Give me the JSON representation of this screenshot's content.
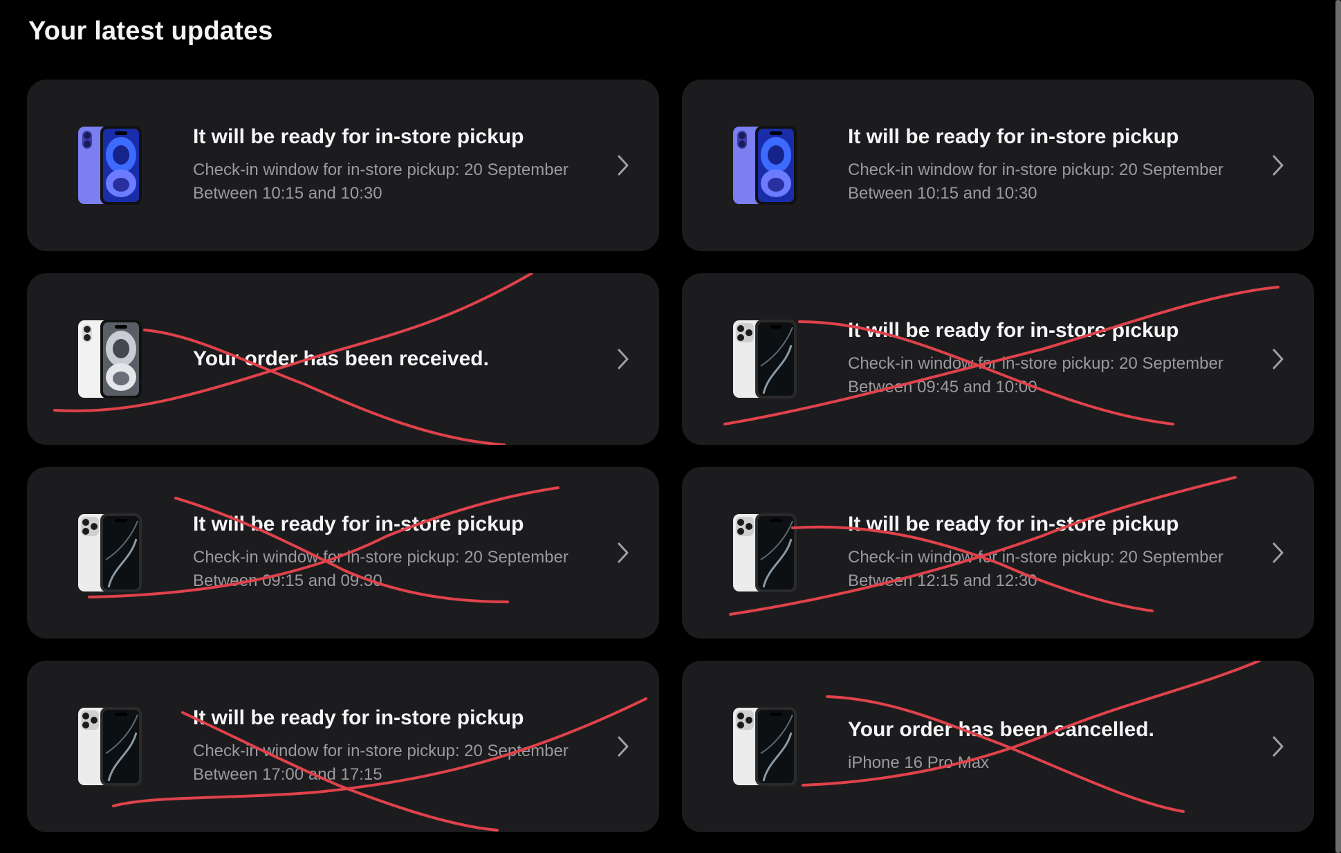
{
  "page": {
    "title": "Your latest updates"
  },
  "colors": {
    "background": "#000000",
    "card": "#1c1c1e",
    "scribble": "#e0424b",
    "muted_text": "#9a9aa0"
  },
  "cards": [
    {
      "phone": "iphone-16-ultramarine-icon",
      "title": "It will be ready for in-store pickup",
      "line1": "Check-in window for in-store pickup: 20 September",
      "line2": "Between 10:15 and 10:30",
      "crossed_out": false
    },
    {
      "phone": "iphone-16-ultramarine-icon",
      "title": "It will be ready for in-store pickup",
      "line1": "Check-in window for in-store pickup: 20 September",
      "line2": "Between 10:15 and 10:30",
      "crossed_out": false
    },
    {
      "phone": "iphone-16-white-icon",
      "title": "Your order has been received.",
      "crossed_out": true
    },
    {
      "phone": "iphone-16-pro-titanium-icon",
      "title": "It will be ready for in-store pickup",
      "line1": "Check-in window for in-store pickup: 20 September",
      "line2": "Between 09:45 and 10:00",
      "crossed_out": true
    },
    {
      "phone": "iphone-16-pro-titanium-icon",
      "title": "It will be ready for in-store pickup",
      "line1": "Check-in window for in-store pickup: 20 September",
      "line2": "Between 09:15 and 09:30",
      "crossed_out": true
    },
    {
      "phone": "iphone-16-pro-titanium-icon",
      "title": "It will be ready for in-store pickup",
      "line1": "Check-in window for in-store pickup: 20 September",
      "line2": "Between 12:15 and 12:30",
      "crossed_out": true
    },
    {
      "phone": "iphone-16-pro-titanium-icon",
      "title": "It will be ready for in-store pickup",
      "line1": "Check-in window for in-store pickup: 20 September",
      "line2": "Between 17:00 and 17:15",
      "crossed_out": true
    },
    {
      "phone": "iphone-16-pro-titanium-icon",
      "title": "Your order has been cancelled.",
      "line1": "iPhone 16 Pro Max",
      "crossed_out": true
    }
  ]
}
